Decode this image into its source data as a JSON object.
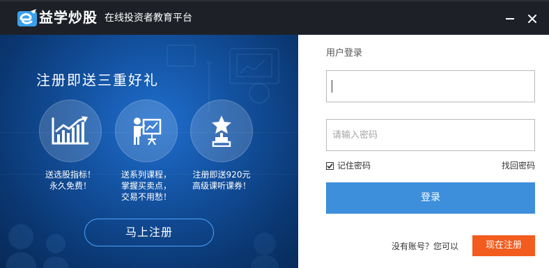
{
  "titlebar": {
    "brand": "益学炒股",
    "tagline": "在线投资者教育平台",
    "minimize_icon": "minimize-icon",
    "close_icon": "close-icon"
  },
  "promo": {
    "title": "注册即送三重好礼",
    "gifts": [
      {
        "icon": "stock-chart-icon",
        "lines": [
          "送选股指标！",
          "永久免费！"
        ]
      },
      {
        "icon": "lecture-board-icon",
        "lines": [
          "送系列课程，",
          "掌握买卖点，",
          "交易不用愁！"
        ]
      },
      {
        "icon": "trophy-star-icon",
        "lines": [
          "注册即送920元",
          "高级课听课券！"
        ]
      }
    ],
    "register_button": "马上注册"
  },
  "login": {
    "title": "用户登录",
    "username": {
      "value": "",
      "placeholder": ""
    },
    "password": {
      "value": "",
      "placeholder": "请输入密码"
    },
    "remember_label": "记住密码",
    "remember_checked": true,
    "forgot_label": "找回密码",
    "login_button": "登录",
    "no_account_text": "没有账号？您可以",
    "signup_button": "现在注册"
  },
  "colors": {
    "titlebar_bg": "#1d2127",
    "promo_blue": "#13519f",
    "login_button": "#3d8fdc",
    "signup_button": "#f25c1f"
  }
}
